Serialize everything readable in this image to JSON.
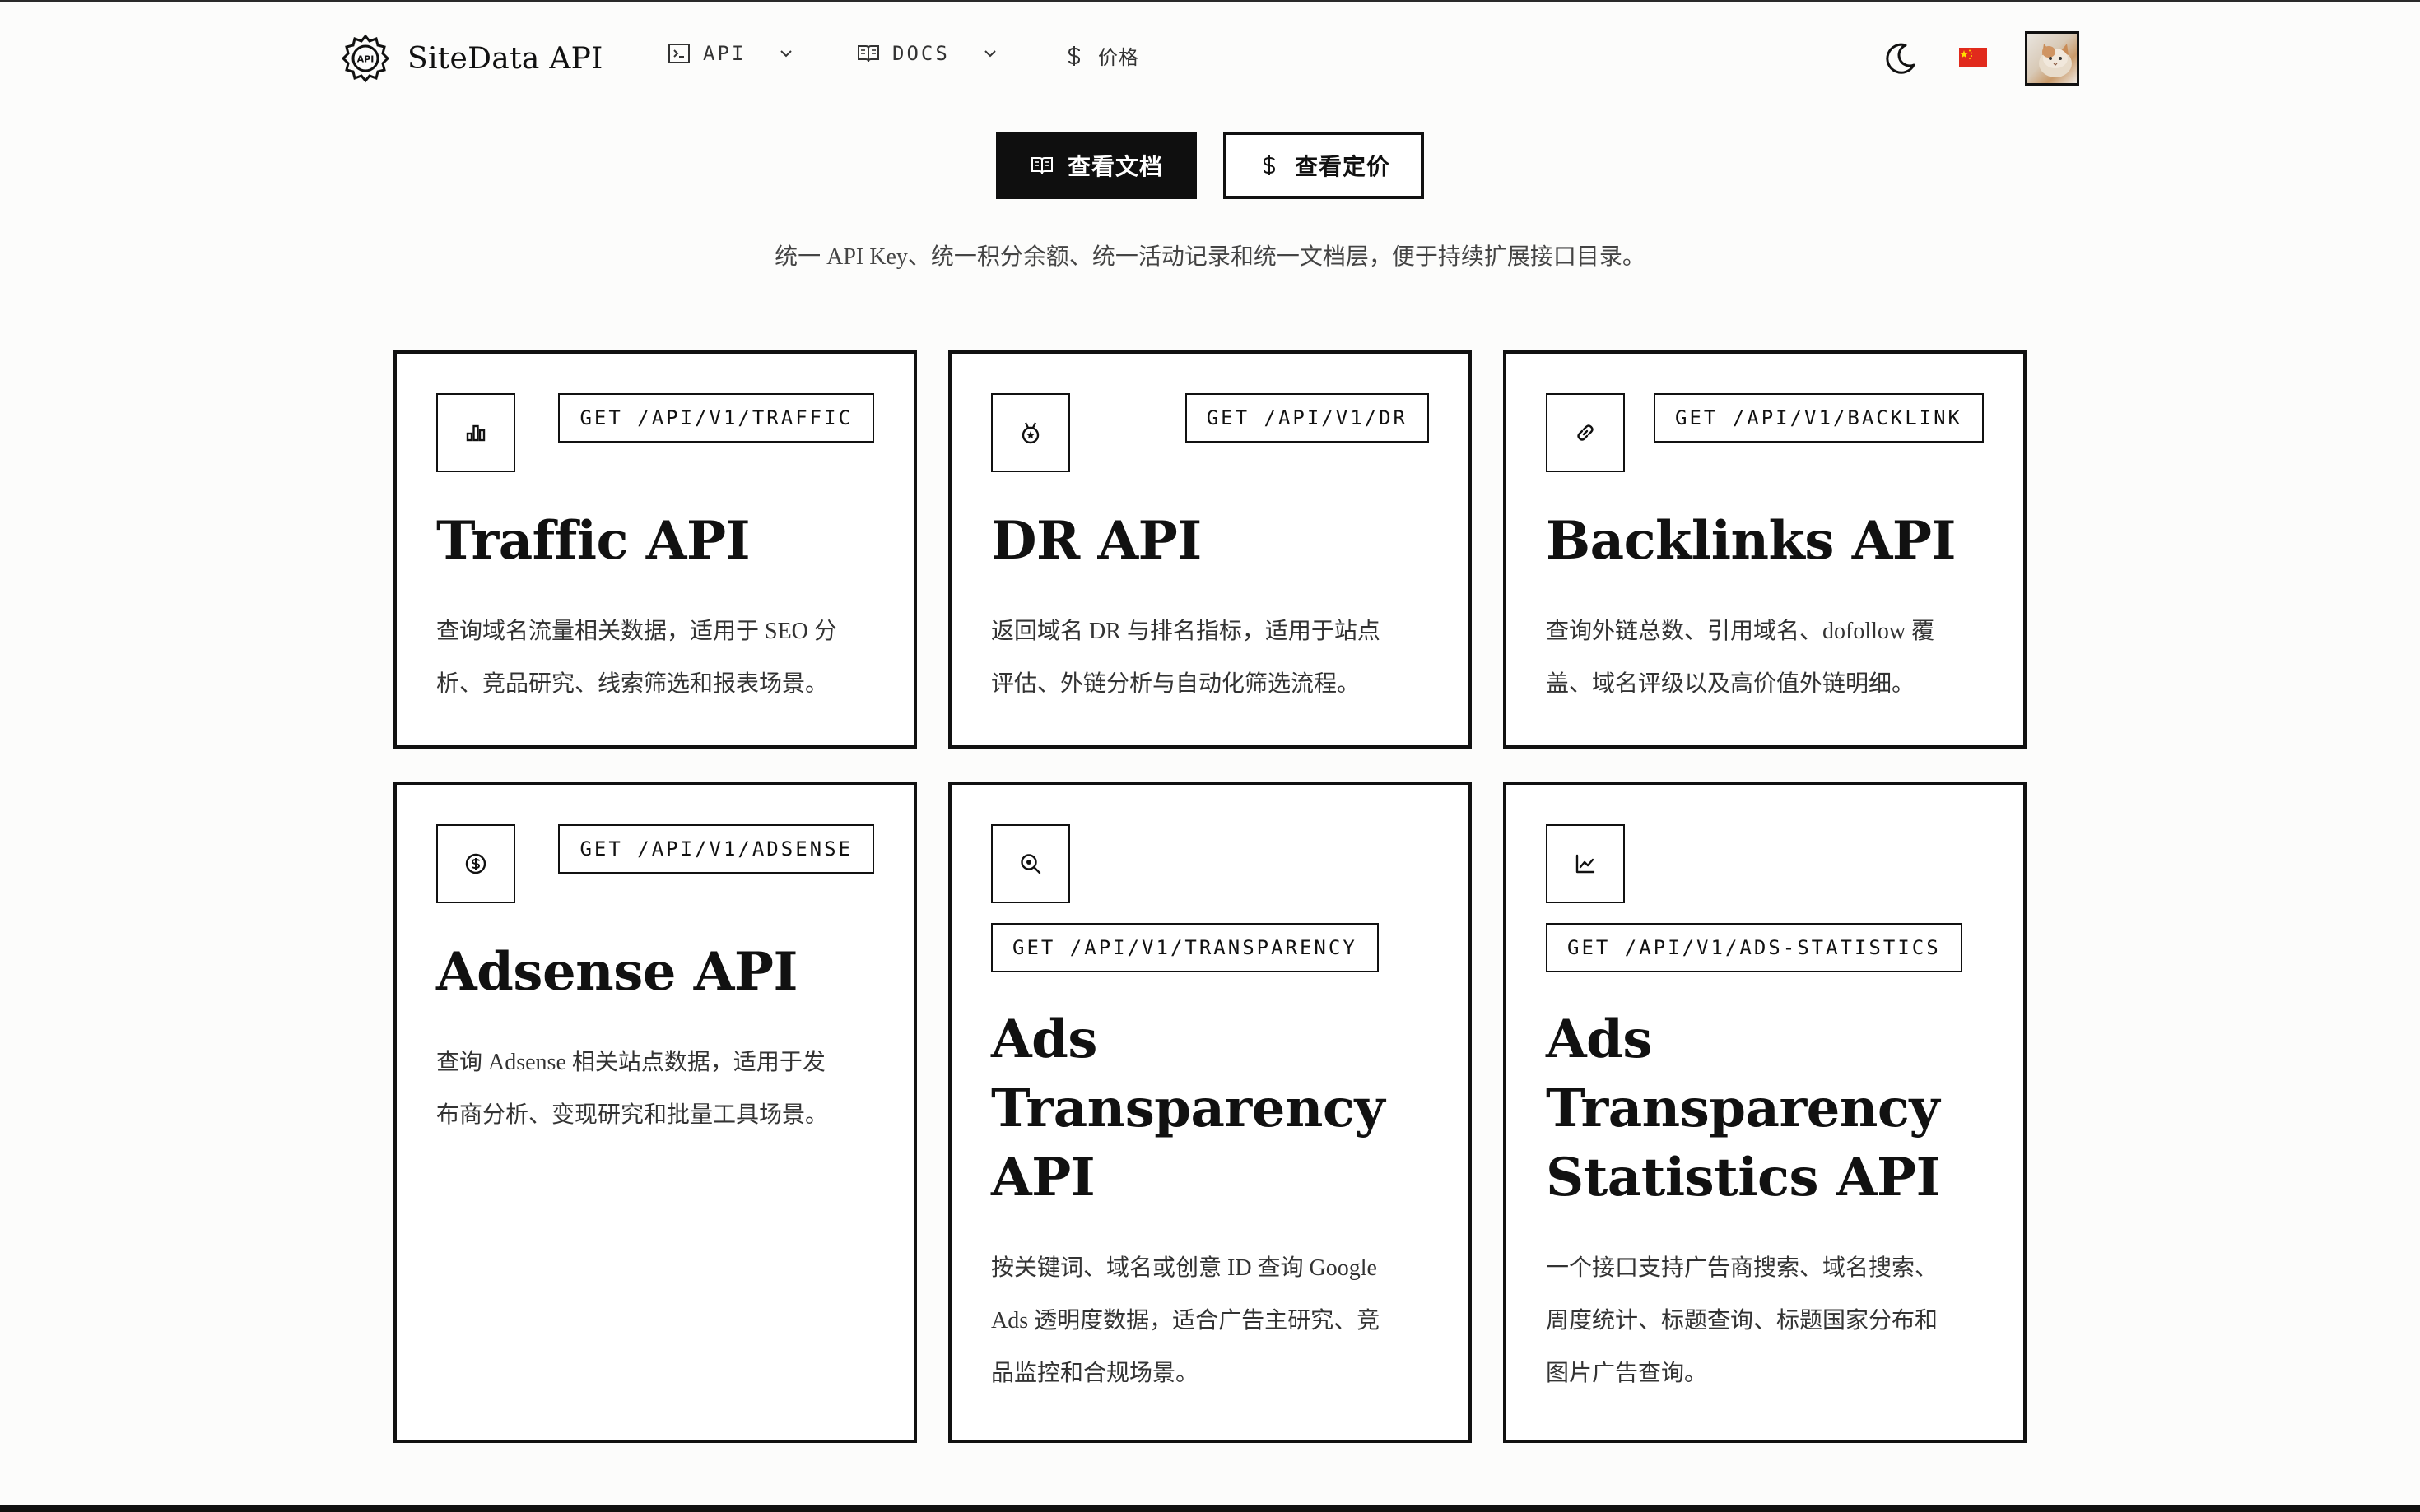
{
  "header": {
    "brand": "SiteData API",
    "nav": [
      {
        "label": "API",
        "icon": "terminal-icon"
      },
      {
        "label": "DOCS",
        "icon": "book-icon"
      },
      {
        "label": "价格",
        "icon": "dollar-icon"
      }
    ],
    "language_flag": "cn-flag-icon"
  },
  "hero": {
    "docs_button": "查看文档",
    "pricing_button": "查看定价",
    "subtitle": "统一 API Key、统一积分余额、统一活动记录和统一文档层，便于持续扩展接口目录。"
  },
  "cards": [
    {
      "icon": "bar-chart-icon",
      "endpoint": "GET /API/V1/TRAFFIC",
      "title": "Traffic API",
      "desc": [
        "查询域名流量相关数据，适用于 SEO 分",
        "析、竞品研究、线索筛选和报表场景。"
      ]
    },
    {
      "icon": "medal-icon",
      "endpoint": "GET /API/V1/DR",
      "title": "DR API",
      "desc": [
        "返回域名 DR 与排名指标，适用于站点",
        "评估、外链分析与自动化筛选流程。"
      ]
    },
    {
      "icon": "link-icon",
      "endpoint": "GET /API/V1/BACKLINK",
      "title": "Backlinks API",
      "desc": [
        "查询外链总数、引用域名、dofollow 覆",
        "盖、域名评级以及高价值外链明细。"
      ]
    },
    {
      "icon": "dollar-circle-icon",
      "endpoint": "GET /API/V1/ADSENSE",
      "title": "Adsense API",
      "desc": [
        "查询 Adsense 相关站点数据，适用于发",
        "布商分析、变现研究和批量工具场景。"
      ]
    },
    {
      "icon": "search-zoom-icon",
      "endpoint": "GET /API/V1/TRANSPARENCY",
      "title": [
        "Ads",
        "Transparency",
        "API"
      ],
      "desc": [
        "按关键词、域名或创意 ID 查询 Google",
        "Ads 透明度数据，适合广告主研究、竞",
        "品监控和合规场景。"
      ]
    },
    {
      "icon": "line-chart-icon",
      "endpoint": "GET /API/V1/ADS-STATISTICS",
      "title": [
        "Ads",
        "Transparency",
        "Statistics API"
      ],
      "desc": [
        "一个接口支持广告商搜索、域名搜索、",
        "周度统计、标题查询、标题国家分布和",
        "图片广告查询。"
      ]
    }
  ]
}
